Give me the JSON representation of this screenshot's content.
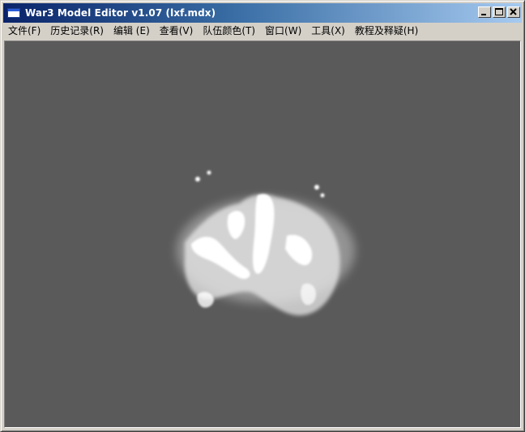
{
  "window": {
    "title": "War3 Model Editor v1.07 (lxf.mdx)"
  },
  "title_buttons": {
    "minimize_icon": "minimize-icon",
    "maximize_icon": "maximize-icon",
    "close_icon": "close-icon"
  },
  "menu": {
    "items": [
      {
        "label": "文件(F)"
      },
      {
        "label": "历史记录(R)"
      },
      {
        "label": "编辑 (E)"
      },
      {
        "label": "查看(V)"
      },
      {
        "label": "队伍颜色(T)"
      },
      {
        "label": "窗口(W)"
      },
      {
        "label": "工具(X)"
      },
      {
        "label": "教程及释疑(H)"
      }
    ]
  },
  "viewport": {
    "background_color": "#5a5a5a",
    "model_color": "#ffffff"
  }
}
